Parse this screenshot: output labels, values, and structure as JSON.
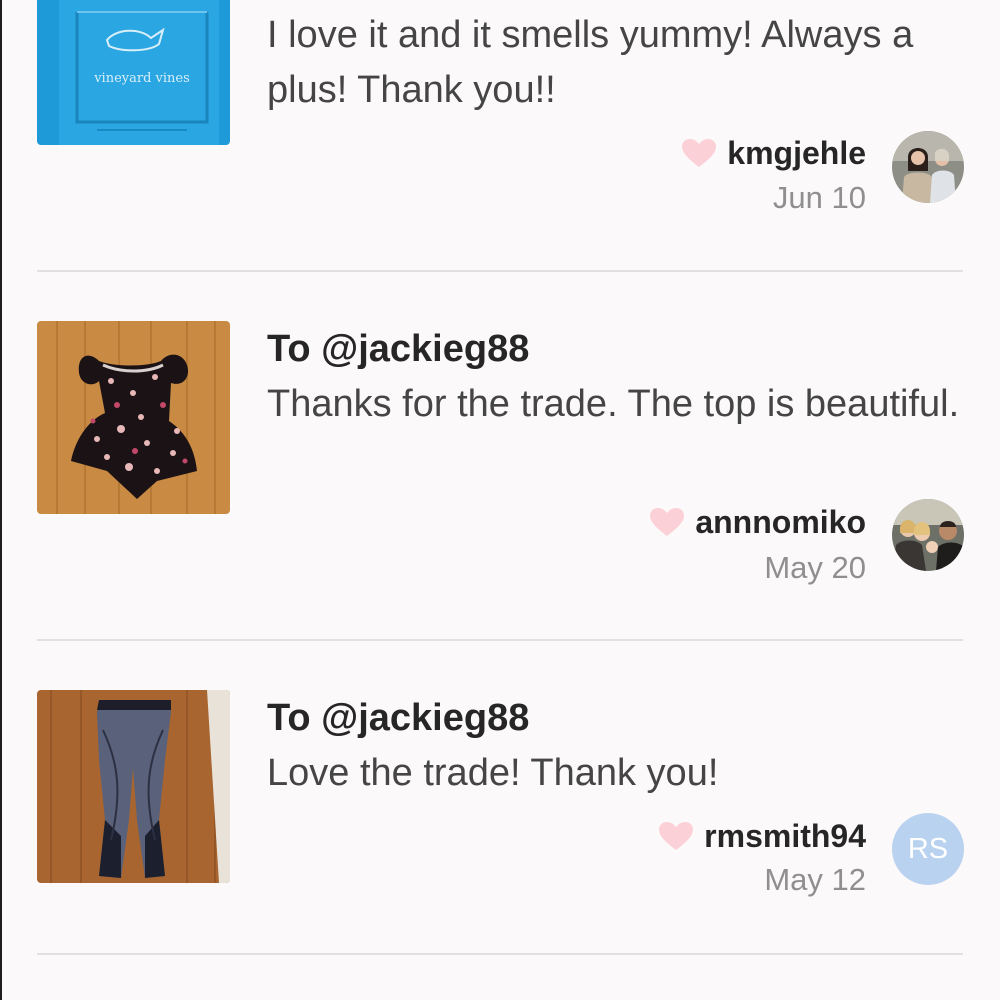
{
  "reviews": [
    {
      "to": "",
      "message": "I love it and it smells yummy! Always a plus! Thank you!!",
      "username": "kmgjehle",
      "date": "Jun 10",
      "thumbnail": "blue-vineyard-vines-shirt",
      "thumbnail_text": "vineyard vines",
      "avatar": "photo"
    },
    {
      "to": "To @jackieg88",
      "message": "Thanks for the trade. The top is beautiful.",
      "username": "annnomiko",
      "date": "May 20",
      "thumbnail": "floral-top-on-wood-floor",
      "avatar": "photo"
    },
    {
      "to": "To @jackieg88",
      "message": "Love the trade! Thank you!",
      "username": "rmsmith94",
      "date": "May 12",
      "thumbnail": "leggings-on-wood-floor",
      "avatar": "initials",
      "avatar_initials": "RS"
    }
  ],
  "icons": {
    "like": "heart-icon"
  },
  "colors": {
    "heart": "#fbd0d6",
    "avatar_initials_bg": "#b9d2ef",
    "username": "#262626",
    "message": "#454545",
    "date": "#8f8f8f",
    "divider": "#e2e0e0"
  }
}
